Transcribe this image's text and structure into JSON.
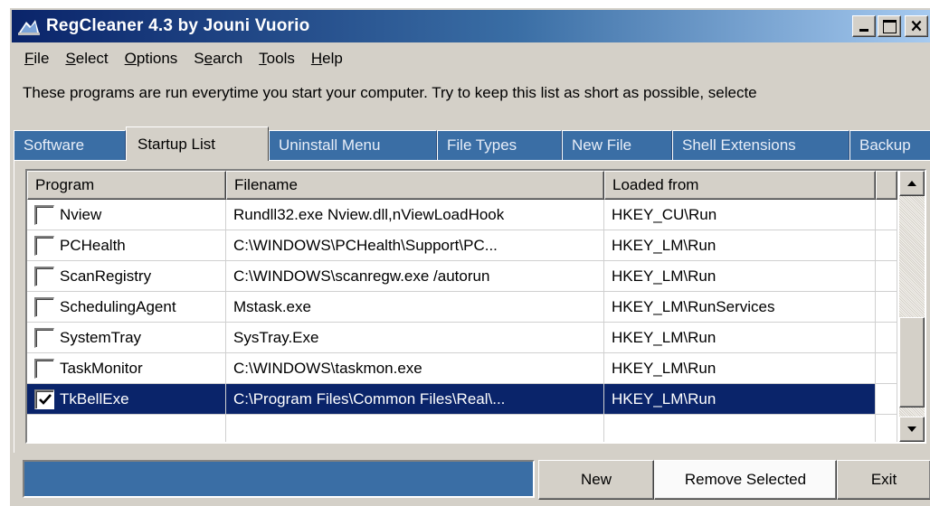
{
  "window": {
    "title": "RegCleaner 4.3 by Jouni Vuorio"
  },
  "menu": [
    {
      "accel": "F",
      "rest": "ile"
    },
    {
      "accel": "S",
      "rest": "elect"
    },
    {
      "accel": "O",
      "rest": "ptions"
    },
    {
      "pre": "S",
      "accel": "e",
      "rest": "arch"
    },
    {
      "accel": "T",
      "rest": "ools"
    },
    {
      "accel": "H",
      "rest": "elp"
    }
  ],
  "info_text": "These programs are run everytime you start your computer. Try to keep this list as short as possible, selecte",
  "tabs": [
    {
      "label": "Software"
    },
    {
      "label": "Startup List"
    },
    {
      "label": "Uninstall Menu"
    },
    {
      "label": "File Types"
    },
    {
      "label": "New File"
    },
    {
      "label": "Shell Extensions"
    },
    {
      "label": "Backup"
    }
  ],
  "columns": {
    "program": "Program",
    "filename": "Filename",
    "loaded_from": "Loaded from"
  },
  "rows": [
    {
      "program": "Nview",
      "filename": "Rundll32.exe Nview.dll,nViewLoadHook",
      "loaded_from": "HKEY_CU\\Run",
      "checked": false
    },
    {
      "program": "PCHealth",
      "filename": "C:\\WINDOWS\\PCHealth\\Support\\PC...",
      "loaded_from": "HKEY_LM\\Run",
      "checked": false
    },
    {
      "program": "ScanRegistry",
      "filename": "C:\\WINDOWS\\scanregw.exe /autorun",
      "loaded_from": "HKEY_LM\\Run",
      "checked": false
    },
    {
      "program": "SchedulingAgent",
      "filename": "Mstask.exe",
      "loaded_from": "HKEY_LM\\RunServices",
      "checked": false
    },
    {
      "program": "SystemTray",
      "filename": "SysTray.Exe",
      "loaded_from": "HKEY_LM\\Run",
      "checked": false
    },
    {
      "program": "TaskMonitor",
      "filename": "C:\\WINDOWS\\taskmon.exe",
      "loaded_from": "HKEY_LM\\Run",
      "checked": false
    },
    {
      "program": "TkBellExe",
      "filename": "C:\\Program Files\\Common Files\\Real\\...",
      "loaded_from": "HKEY_LM\\Run",
      "checked": true,
      "selected": true
    },
    {
      "program": "",
      "filename": "",
      "loaded_from": "",
      "checked": null
    }
  ],
  "buttons": {
    "new": "New",
    "remove_selected": "Remove Selected",
    "exit": "Exit"
  },
  "colors": {
    "title_gradient_start": "#0a246a",
    "title_gradient_end": "#a6caf0",
    "selection": "#0a246a",
    "tab_inactive": "#3a6ea5",
    "face": "#d4d0c8"
  }
}
